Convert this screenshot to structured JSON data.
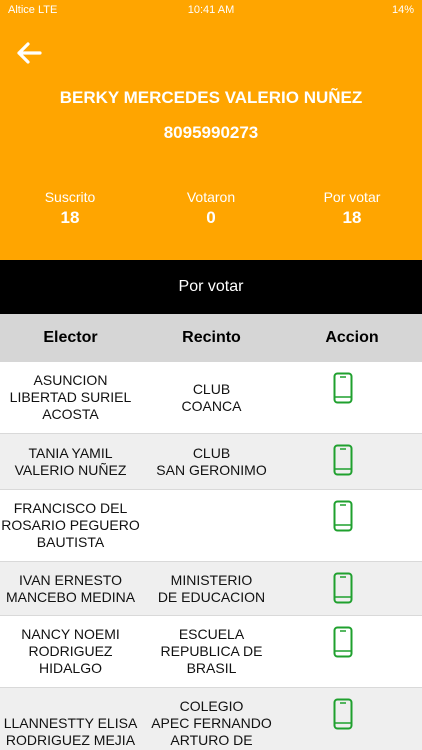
{
  "status_bar": {
    "carrier": "Altice  LTE",
    "time": "10:41 AM",
    "battery": "14%"
  },
  "header": {
    "back_icon": "arrow-left-icon",
    "name": "BERKY MERCEDES VALERIO NUÑEZ",
    "phone": "8095990273",
    "stats": [
      {
        "label": "Suscrito",
        "value": "18"
      },
      {
        "label": "Votaron",
        "value": "0"
      },
      {
        "label": "Por votar",
        "value": "18"
      }
    ]
  },
  "tab": {
    "label": "Por votar"
  },
  "table": {
    "headers": [
      "Elector",
      "Recinto",
      "Accion"
    ],
    "rows": [
      {
        "elector": "ASUNCION\nLIBERTAD SURIEL\nACOSTA",
        "recinto": "CLUB\nCOANCA"
      },
      {
        "elector": "TANIA YAMIL\nVALERIO NUÑEZ",
        "recinto": "CLUB\nSAN GERONIMO"
      },
      {
        "elector": "FRANCISCO DEL\nROSARIO PEGUERO\nBAUTISTA",
        "recinto": ""
      },
      {
        "elector": "IVAN ERNESTO\nMANCEBO MEDINA",
        "recinto": "MINISTERIO\nDE EDUCACION"
      },
      {
        "elector": "NANCY NOEMI\nRODRIGUEZ\nHIDALGO",
        "recinto": "ESCUELA\nREPUBLICA DE\nBRASIL"
      },
      {
        "elector": "LLANNESTTY ELISA\nRODRIGUEZ MEJIA",
        "recinto": "COLEGIO\nAPEC FERNANDO\nARTURO DE"
      }
    ],
    "action_icon": "mobile-phone-icon"
  },
  "colors": {
    "header_bg": "#ffa500",
    "tab_bg": "#000000",
    "table_header_bg": "#d6d6d6",
    "row_alt_bg": "#efefef",
    "phone_icon": "#1fa02e"
  }
}
